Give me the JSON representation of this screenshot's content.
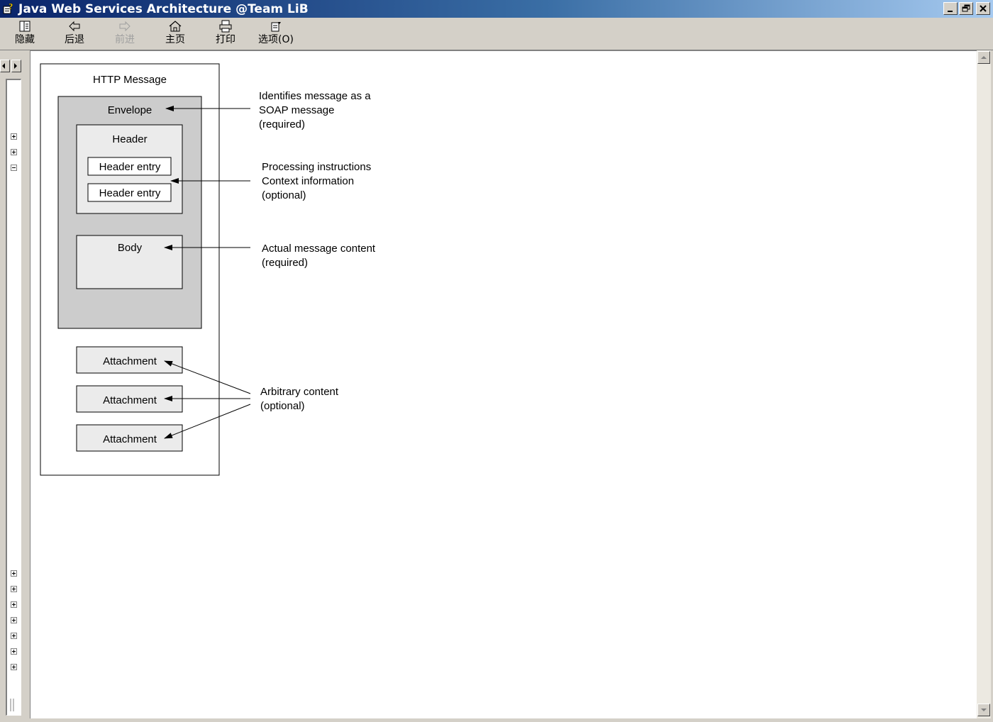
{
  "window": {
    "title": "Java Web Services Architecture @Team LiB",
    "controls": [
      "minimize",
      "restore",
      "close"
    ]
  },
  "toolbar": {
    "buttons": [
      {
        "label": "隐藏",
        "icon": "hide-pane-icon",
        "enabled": true
      },
      {
        "label": "后退",
        "icon": "back-arrow-icon",
        "enabled": true
      },
      {
        "label": "前进",
        "icon": "forward-arrow-icon",
        "enabled": false
      },
      {
        "label": "主页",
        "icon": "home-icon",
        "enabled": true
      },
      {
        "label": "打印",
        "icon": "printer-icon",
        "enabled": true
      },
      {
        "label": "选项(O)",
        "icon": "options-icon",
        "enabled": true
      }
    ]
  },
  "tree": {
    "expanders": [
      "plus",
      "plus",
      "minus",
      "plus",
      "plus",
      "plus",
      "plus",
      "plus",
      "plus",
      "plus"
    ]
  },
  "diagram": {
    "http_message": "HTTP Message",
    "envelope": "Envelope",
    "header": "Header",
    "header_entries": [
      "Header entry",
      "Header entry"
    ],
    "body": "Body",
    "attachments": [
      "Attachment",
      "Attachment",
      "Attachment"
    ],
    "annotations": {
      "envelope": [
        "Identifies message as a",
        "SOAP message",
        "(required)"
      ],
      "header": [
        "Processing instructions",
        "Context information",
        "(optional)"
      ],
      "body": [
        "Actual message content",
        "(required)"
      ],
      "attachments": [
        "Arbitrary content",
        "(optional)"
      ]
    }
  },
  "colors": {
    "titlebar_start": "#0a246a",
    "titlebar_end": "#a6caf0",
    "envelope_fill": "#cccccc",
    "inner_box_fill": "#ebebeb",
    "chrome": "#d4d0c8"
  }
}
